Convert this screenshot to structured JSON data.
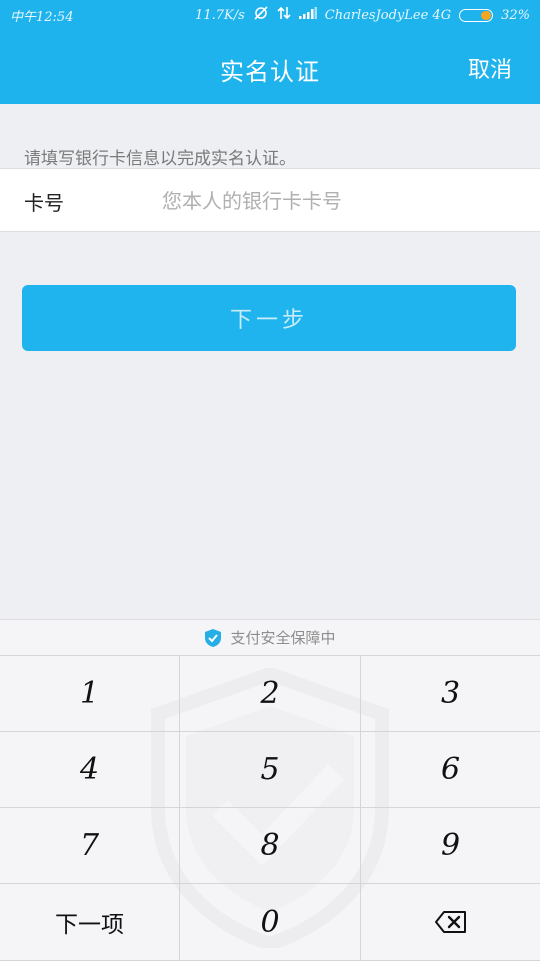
{
  "status_bar": {
    "time": "中午12:54",
    "network_speed": "11.7K/s",
    "carrier": "CharlesJodyLee 4G",
    "battery_level": 0.32,
    "battery_text": "32%"
  },
  "header": {
    "title": "实名认证",
    "cancel_label": "取消"
  },
  "form": {
    "hint": "请填写银行卡信息以完成实名认证。",
    "card_label": "卡号",
    "card_value": "",
    "card_placeholder": "您本人的银行卡卡号"
  },
  "next_button": {
    "label": "下一步"
  },
  "keyboard": {
    "security_text": "支付安全保障中",
    "keys": [
      "1",
      "2",
      "3",
      "4",
      "5",
      "6",
      "7",
      "8",
      "9",
      "下一项",
      "0"
    ],
    "backspace_icon": "backspace-icon"
  },
  "colors": {
    "header_bg": "#1eb3ec",
    "button_bg": "#1fb4ed",
    "page_bg": "#eeeff3",
    "battery": "#f5a623"
  }
}
